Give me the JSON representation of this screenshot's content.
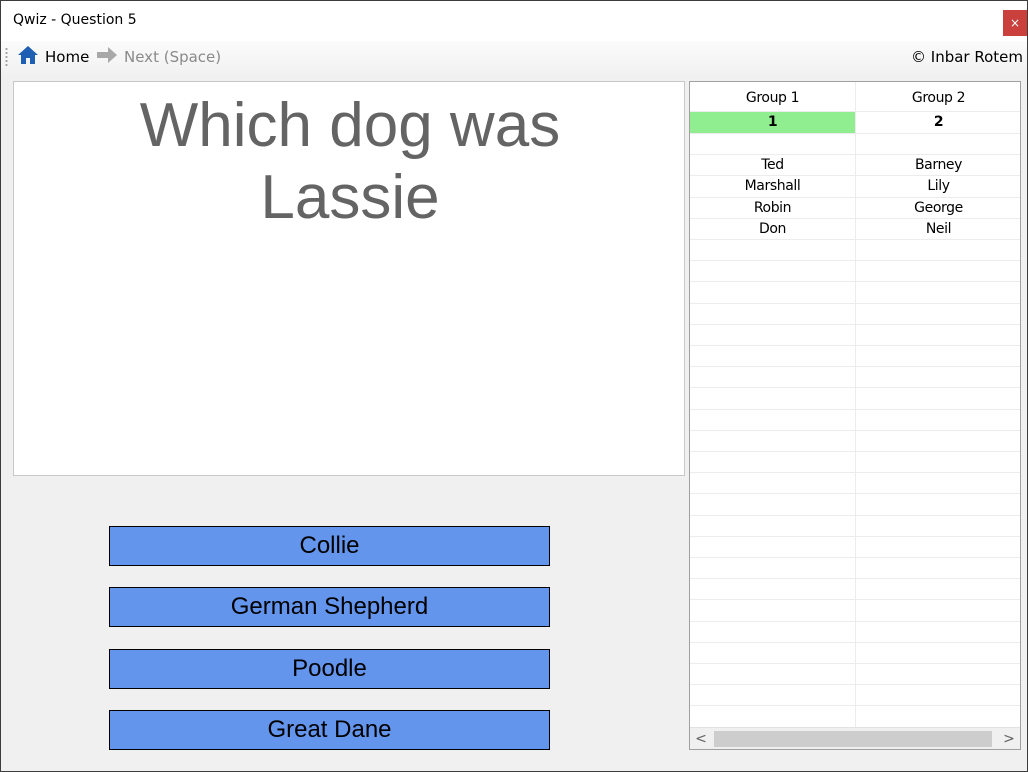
{
  "window": {
    "title": "Qwiz - Question 5",
    "close_label": "×"
  },
  "toolbar": {
    "home_label": "Home",
    "next_label": "Next (Space)",
    "copyright": "© Inbar Rotem"
  },
  "question": {
    "text": "Which dog was Lassie"
  },
  "answers": [
    "Collie",
    "German Shepherd",
    "Poodle",
    "Great Dane"
  ],
  "groups": {
    "headers": [
      "Group 1",
      "Group 2"
    ],
    "scores": [
      "1",
      "2"
    ],
    "active_group_index": 0,
    "members": [
      [
        "Ted",
        "Barney"
      ],
      [
        "Marshall",
        "Lily"
      ],
      [
        "Robin",
        "George"
      ],
      [
        "Don",
        "Neil"
      ]
    ]
  },
  "colors": {
    "answer_bg": "#6495ed",
    "active_score_bg": "#90ee90",
    "close_bg": "#c9403c",
    "question_text": "#646464"
  },
  "icons": {
    "home": "home-icon",
    "next": "arrow-right-icon",
    "scroll_left": "chevron-left-icon",
    "scroll_right": "chevron-right-icon"
  }
}
